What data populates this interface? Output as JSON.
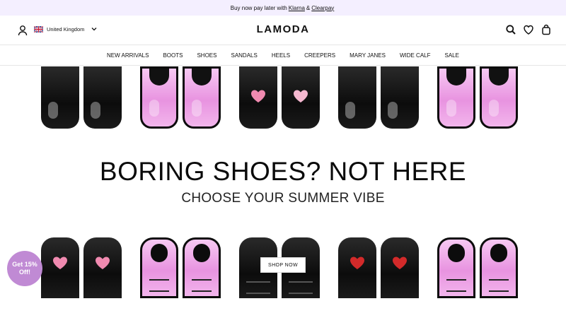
{
  "promo": {
    "prefix": "Buy now pay later with",
    "klarna": "Klarna",
    "amp": "&",
    "clearpay": "Clearpay"
  },
  "header": {
    "country": "United Kingdom",
    "logo": "LAMODA",
    "icons": [
      "account-icon",
      "uk-flag-icon",
      "chevron-down-icon",
      "search-icon",
      "heart-icon",
      "bag-icon"
    ]
  },
  "nav": {
    "items": [
      "NEW ARRIVALS",
      "BOOTS",
      "SHOES",
      "SANDALS",
      "HEELS",
      "CREEPERS",
      "MARY JANES",
      "WIDE CALF",
      "SALE"
    ]
  },
  "hero": {
    "headline": "BORING SHOES? NOT HERE",
    "subhead": "CHOOSE YOUR SUMMER VIBE",
    "cta": "SHOP NOW"
  },
  "badge": {
    "line1": "Get 15%",
    "line2": "Off!"
  },
  "colors": {
    "promo_bg": "#f4efff",
    "badge": "#c08ad4",
    "shoe_pink": "#e893e0",
    "shoe_black": "#0c0c0c",
    "heart_pink": "#f08ab0",
    "heart_red": "#d32a2a"
  }
}
